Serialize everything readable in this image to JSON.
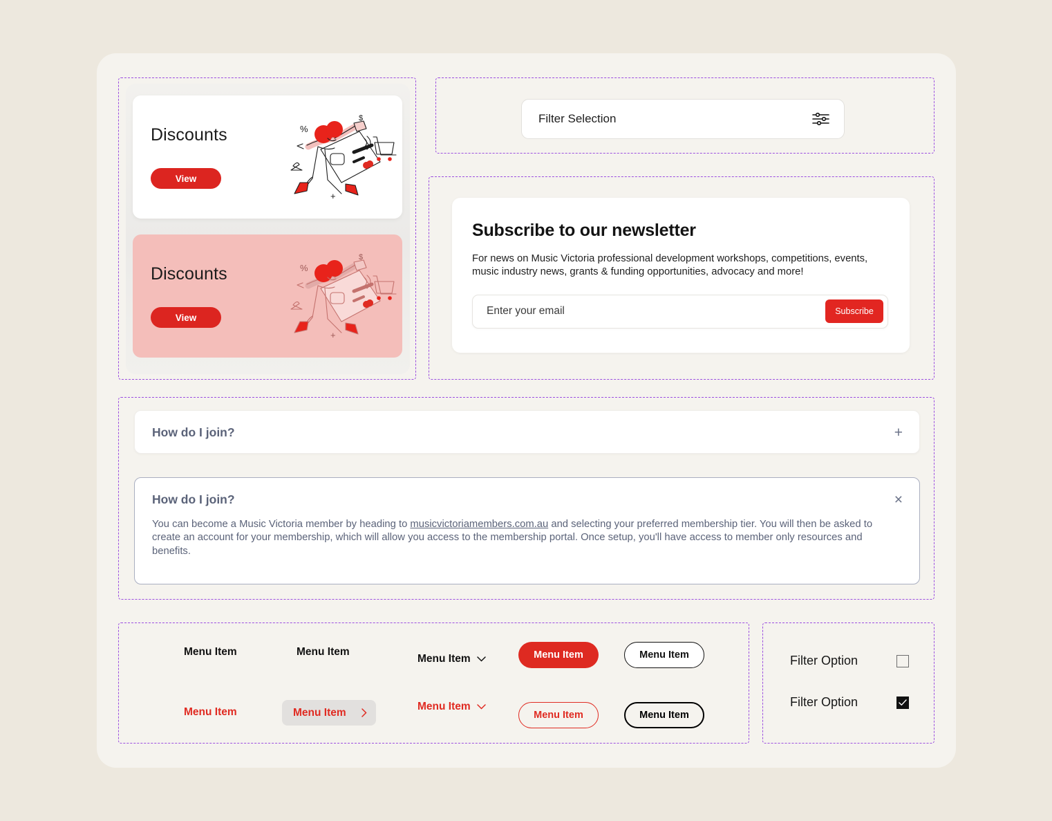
{
  "theme": {
    "page_bg": "#EDE8DE",
    "panel_bg": "#F5F3EE",
    "accent_red": "#DC2520",
    "dashed_border": "#9B4DE0",
    "slate_text": "#5B6379",
    "pink_card": "#F4BEBA"
  },
  "discounts": {
    "card_light": {
      "title": "Discounts",
      "button_label": "View",
      "illustration": "shopping-discount-illustration"
    },
    "card_pink": {
      "title": "Discounts",
      "button_label": "View",
      "illustration": "shopping-discount-illustration"
    }
  },
  "filter_selection": {
    "label": "Filter Selection",
    "icon": "sliders-filter-icon"
  },
  "newsletter": {
    "title": "Subscribe to our newsletter",
    "body": "For news on Music Victoria professional development workshops, competitions, events, music industry news, grants & funding opportunities, advocacy and more!",
    "email_placeholder": "Enter your email",
    "email_value": "",
    "subscribe_label": "Subscribe"
  },
  "faq": {
    "collapsed": {
      "question": "How do I join?",
      "toggle_icon": "plus-icon",
      "toggle_glyph": "+"
    },
    "expanded": {
      "question": "How do I join?",
      "toggle_icon": "close-icon",
      "toggle_glyph": "×",
      "answer_part1": "You can become a Music Victoria member by heading to ",
      "answer_link": "musicvictoriamembers.com.au",
      "answer_part2": " and selecting your preferred membership tier. You will then be asked to create an account for your membership, which will allow you access to the membership portal. Once setup, you'll have access to member only resources and benefits."
    }
  },
  "menu": {
    "row1": {
      "plain": "Menu Item",
      "plain2": "Menu Item",
      "dropdown": "Menu Item",
      "filled_pill": "Menu Item",
      "ghost_pill": "Menu Item"
    },
    "row2": {
      "plain_red": "Menu Item",
      "gray_button": "Menu Item",
      "dropdown_red": "Menu Item",
      "redline_pill": "Menu Item",
      "dark_pill": "Menu Item"
    }
  },
  "filter_options": [
    {
      "label": "Filter Option",
      "checked": false
    },
    {
      "label": "Filter Option",
      "checked": true
    }
  ]
}
